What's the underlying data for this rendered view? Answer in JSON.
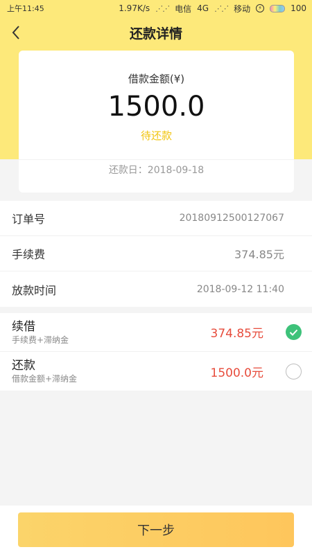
{
  "status_bar": {
    "time": "上午11:45",
    "speed": "1.97K/s",
    "carrier1": "电信",
    "network1": "4G",
    "carrier2": "移动",
    "battery": "100"
  },
  "navbar": {
    "title": "还款详情",
    "back_icon": "chevron-left-icon"
  },
  "amount_card": {
    "label": "借款金额(¥)",
    "amount": "1500.0",
    "status": "待还款",
    "due_date": "还款日：2018-09-18"
  },
  "info": [
    {
      "label": "订单号",
      "value": "20180912500127067"
    },
    {
      "label": "手续费",
      "value": "374.85元"
    },
    {
      "label": "放款时间",
      "value": "2018-09-12 11:40"
    }
  ],
  "options": [
    {
      "title": "续借",
      "subtitle": "手续费+滞纳金",
      "amount": "374.85元",
      "selected": true
    },
    {
      "title": "还款",
      "subtitle": "借款金额+滞纳金",
      "amount": "1500.0元",
      "selected": false
    }
  ],
  "bottom": {
    "next_label": "下一步"
  },
  "colors": {
    "brand_yellow": "#fde97a",
    "status_yellow": "#f1c40f",
    "amount_red": "#e74c3c",
    "check_green": "#3ec27a"
  }
}
